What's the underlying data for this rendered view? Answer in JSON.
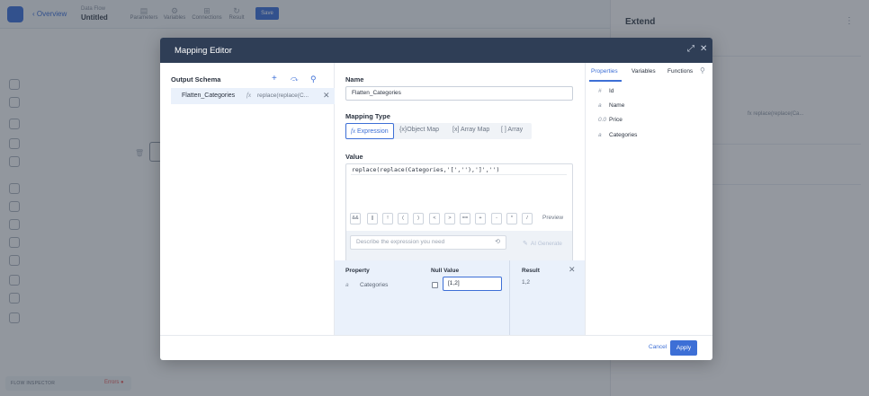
{
  "background": {
    "overview": "Overview",
    "dataflow_label": "Data Flow",
    "dataflow_name": "Untitled",
    "toolbar": [
      {
        "label": "Parameters",
        "icon": "parameters-icon"
      },
      {
        "label": "Variables",
        "icon": "variables-icon"
      },
      {
        "label": "Connections",
        "icon": "connections-icon"
      },
      {
        "label": "Result",
        "icon": "result-icon"
      }
    ],
    "save": "Save",
    "panel_title": "Extend",
    "panel_fx": "fx  replace(replace(Ca...",
    "flow_inspector": "FLOW INSPECTOR",
    "errors": "Errors"
  },
  "modal": {
    "title": "Mapping Editor",
    "output_schema": {
      "title": "Output Schema",
      "row": {
        "name": "Flatten_Categories",
        "expr": "replace(replace(C..."
      }
    },
    "name": {
      "label": "Name",
      "value": "Flatten_Categories"
    },
    "mapping_type": {
      "label": "Mapping Type",
      "options": [
        "Expression",
        "Object Map",
        "Array Map",
        "Array"
      ],
      "prefixes": [
        "fx",
        "{x}",
        "[x]",
        "[ ]"
      ],
      "selected": "Expression"
    },
    "value": {
      "label": "Value",
      "code": "replace(replace(Categories,'[',''),']','')"
    },
    "operators": [
      "&&",
      "||",
      "!",
      "(",
      ")",
      "<",
      ">",
      "==",
      "+",
      "-",
      "*",
      "/"
    ],
    "preview": "Preview",
    "ai": {
      "placeholder": "Describe the expression you need",
      "generate": "AI Generate"
    },
    "test": {
      "headers": {
        "property": "Property",
        "null_value": "Null Value",
        "result": "Result"
      },
      "property": "Categories",
      "null_value": "[1,2]",
      "result": "1,2"
    },
    "tabs": [
      "Properties",
      "Variables",
      "Functions"
    ],
    "active_tab": "Properties",
    "properties": [
      {
        "type": "#",
        "name": "Id"
      },
      {
        "type": "a",
        "name": "Name"
      },
      {
        "type": "0.0",
        "name": "Price"
      },
      {
        "type": "a",
        "name": "Categories"
      }
    ],
    "footer": {
      "cancel": "Cancel",
      "apply": "Apply"
    }
  }
}
